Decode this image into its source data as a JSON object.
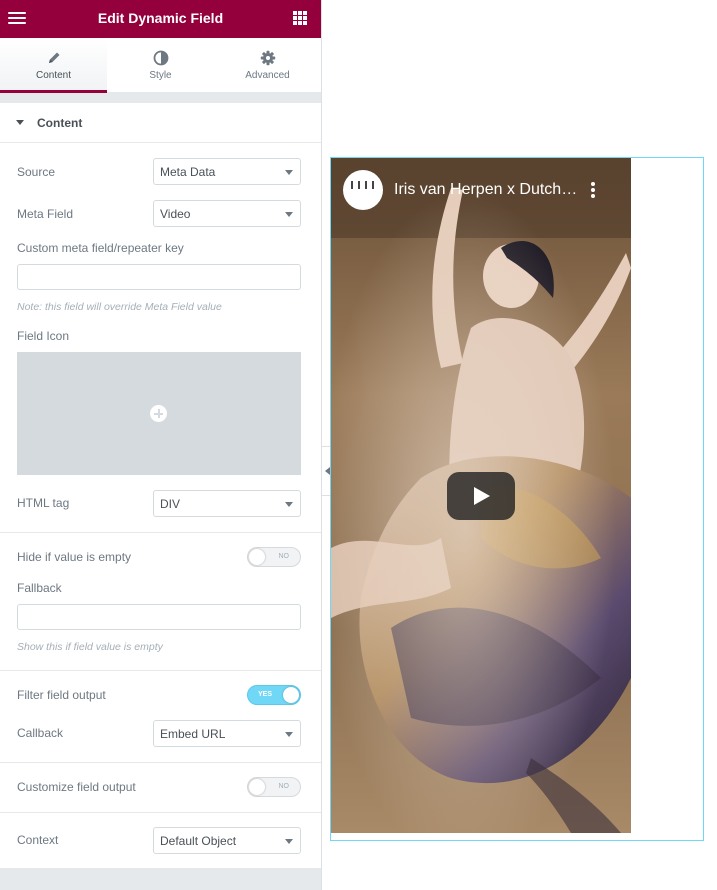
{
  "header": {
    "title": "Edit Dynamic Field"
  },
  "tabs": [
    {
      "label": "Content",
      "icon": "pencil-icon",
      "active": true
    },
    {
      "label": "Style",
      "icon": "half-circle-icon",
      "active": false
    },
    {
      "label": "Advanced",
      "icon": "gear-icon",
      "active": false
    }
  ],
  "section": {
    "title": "Content"
  },
  "fields": {
    "source": {
      "label": "Source",
      "value": "Meta Data"
    },
    "meta_field": {
      "label": "Meta Field",
      "value": "Video"
    },
    "custom_key": {
      "label": "Custom meta field/repeater key",
      "value": "",
      "note": "Note: this field will override Meta Field value"
    },
    "field_icon": {
      "label": "Field Icon"
    },
    "html_tag": {
      "label": "HTML tag",
      "value": "DIV"
    },
    "hide_empty": {
      "label": "Hide if value is empty",
      "toggle": "NO"
    },
    "fallback": {
      "label": "Fallback",
      "value": "",
      "note": "Show this if field value is empty"
    },
    "filter_output": {
      "label": "Filter field output",
      "toggle": "YES"
    },
    "callback": {
      "label": "Callback",
      "value": "Embed URL"
    },
    "customize_output": {
      "label": "Customize field output",
      "toggle": "NO"
    },
    "context": {
      "label": "Context",
      "value": "Default Object"
    }
  },
  "video": {
    "title": "Iris van Herpen x Dutch National Ballet"
  },
  "colors": {
    "brand": "#93003c",
    "toggle_on": "#71d7f7",
    "frame": "#71d7f7"
  }
}
